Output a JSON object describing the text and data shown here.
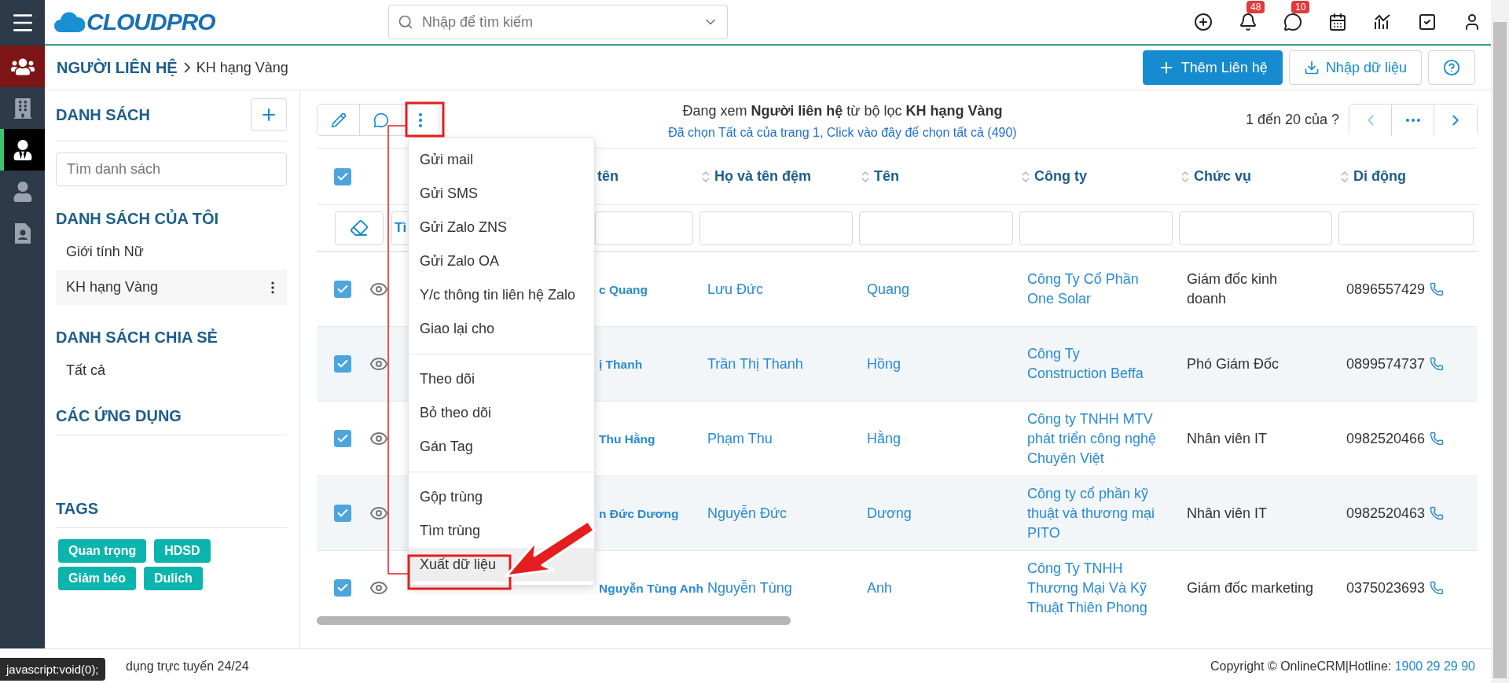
{
  "header": {
    "logo_text": "CLOUDPRO",
    "search": {
      "placeholder": "Nhập để tìm kiếm"
    },
    "icons": [
      {
        "kind": "add"
      },
      {
        "kind": "bell",
        "badge": "48"
      },
      {
        "kind": "chat",
        "badge": "10"
      },
      {
        "kind": "calendar"
      },
      {
        "kind": "chart"
      },
      {
        "kind": "task"
      },
      {
        "kind": "user"
      }
    ]
  },
  "rail": [
    {
      "kind": "group",
      "selected": false
    },
    {
      "kind": "building",
      "selected": false
    },
    {
      "kind": "contact",
      "selected": true
    },
    {
      "kind": "person",
      "selected": false
    },
    {
      "kind": "document",
      "selected": false
    }
  ],
  "breadcrumb": {
    "module": "NGƯỜI LIÊN HỆ",
    "current": "KH hạng Vàng"
  },
  "actions": [
    {
      "kind": "primary",
      "label": "Thêm Liên hệ"
    },
    {
      "kind": "import",
      "label": "Nhập dữ liệu"
    },
    {
      "kind": "help"
    }
  ],
  "sidebar": {
    "title": "DANH SÁCH",
    "search": {
      "placeholder": "Tìm danh sách"
    },
    "sections": [
      {
        "title": "DANH SÁCH CỦA TÔI",
        "items": [
          {
            "label": "Giới tính Nữ",
            "selected": false
          },
          {
            "label": "KH hạng Vàng",
            "selected": true
          }
        ]
      },
      {
        "title": "DANH SÁCH CHIA SẺ",
        "items": [
          {
            "label": "Tất cả",
            "selected": false
          }
        ]
      }
    ],
    "apps_title": "CÁC ỨNG DỤNG",
    "tags_title": "TAGS",
    "tags": [
      {
        "label": "Quan trọng",
        "color": "#0bb5ae"
      },
      {
        "label": "HDSD",
        "color": "#0bb5ae"
      },
      {
        "label": "Giảm béo",
        "color": "#0bb5ae"
      },
      {
        "label": "Dulich",
        "color": "#0bb5ae"
      }
    ]
  },
  "toolbar": {
    "viewing": "Đang xem **Người liên hệ** từ bộ lọc **KH hạng Vàng**",
    "select_all": "Đã chọn Tất cả của trang 1, Click vào đây để chọn tất cả (490)",
    "pagination": "1 đến 20 của ?",
    "prev_disabled": true
  },
  "table": {
    "all_checked": true,
    "columns": [
      "tên",
      "Họ và tên đệm",
      "Tên",
      "Công ty",
      "Chức vụ",
      "Di động"
    ],
    "filter_button": "Tì",
    "rows": [
      {
        "checked": true,
        "name": "c Quang",
        "middle": "Lưu Đức",
        "first": "Quang",
        "company": [
          "Công Ty Cổ Phần",
          "One Solar"
        ],
        "title": [
          "Giám đốc kinh",
          "doanh"
        ],
        "phone": "0896557429"
      },
      {
        "checked": true,
        "name": "ị Thanh",
        "middle": "Trần Thị Thanh",
        "first": "Hồng",
        "company": [
          "Công Ty",
          "Construction Beffa"
        ],
        "title": [
          "Phó Giám Đốc"
        ],
        "phone": "0899574737"
      },
      {
        "checked": true,
        "name": "Thu Hằng",
        "middle": "Phạm Thu",
        "first": "Hằng",
        "company": [
          "Công ty TNHH MTV",
          "phát triển công nghệ",
          "Chuyên Việt"
        ],
        "title": [
          "Nhân viên IT"
        ],
        "phone": "0982520466"
      },
      {
        "checked": true,
        "name": "n Đức Dương",
        "middle": "Nguyễn Đức",
        "first": "Dương",
        "company": [
          "Công ty cổ phần kỹ",
          "thuật và thương mại",
          "PITO"
        ],
        "title": [
          "Nhân viên IT"
        ],
        "phone": "0982520463"
      },
      {
        "checked": true,
        "name": "Nguyễn Tùng Anh",
        "middle": "Nguyễn Tùng",
        "first": "Anh",
        "company": [
          "Công Ty TNHH",
          "Thương Mại Và Kỹ",
          "Thuật Thiên Phong"
        ],
        "title": [
          "Giám đốc marketing"
        ],
        "phone": "0375023693"
      }
    ]
  },
  "menu": {
    "groups": [
      [
        {
          "label": "Gửi mail",
          "selected": false
        },
        {
          "label": "Gửi SMS",
          "selected": false
        },
        {
          "label": "Gửi Zalo ZNS",
          "selected": false
        },
        {
          "label": "Gửi Zalo OA",
          "selected": false
        },
        {
          "label": "Y/c thông tin liên hệ Zalo",
          "selected": false
        },
        {
          "label": "Giao lại cho",
          "selected": false
        }
      ],
      [
        {
          "label": "Theo dõi",
          "selected": false
        },
        {
          "label": "Bỏ theo dõi",
          "selected": false
        },
        {
          "label": "Gán Tag",
          "selected": false
        }
      ],
      [
        {
          "label": "Gộp trùng",
          "selected": false
        },
        {
          "label": "Tìm trùng",
          "selected": false
        },
        {
          "label": "Xuất dữ liệu",
          "selected": true
        }
      ]
    ]
  },
  "footer": {
    "status": "dụng trực tuyến 24/24",
    "tooltip": "javascript:void(0);",
    "copyright": "Copyright © OnlineCRM|Hotline: ",
    "hotline": "1900 29 29 90"
  }
}
